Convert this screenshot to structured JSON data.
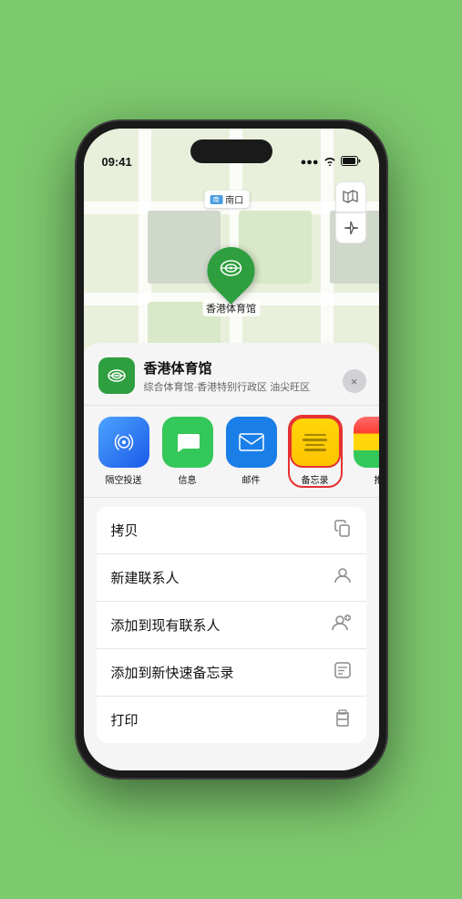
{
  "status_bar": {
    "time": "09:41",
    "location_arrow": "▶",
    "signal": "●●●",
    "wifi": "WiFi",
    "battery": "🔋"
  },
  "map": {
    "label_text": "南口",
    "controls": {
      "map_icon": "🗺",
      "location_icon": "➤"
    }
  },
  "venue": {
    "name": "香港体育馆",
    "subtitle": "综合体育馆·香港特别行政区 油尖旺区",
    "close_label": "×"
  },
  "share_items": [
    {
      "id": "airdrop",
      "label": "隔空投送",
      "icon": "📡"
    },
    {
      "id": "messages",
      "label": "信息",
      "icon": "💬"
    },
    {
      "id": "mail",
      "label": "邮件",
      "icon": "✉"
    },
    {
      "id": "notes",
      "label": "备忘录",
      "icon": "📝"
    },
    {
      "id": "more",
      "label": "推",
      "icon": "⋯"
    }
  ],
  "actions": [
    {
      "id": "copy",
      "label": "拷贝",
      "icon": "⧉"
    },
    {
      "id": "new-contact",
      "label": "新建联系人",
      "icon": "👤"
    },
    {
      "id": "add-contact",
      "label": "添加到现有联系人",
      "icon": "👤+"
    },
    {
      "id": "quick-note",
      "label": "添加到新快速备忘录",
      "icon": "📋"
    },
    {
      "id": "print",
      "label": "打印",
      "icon": "🖨"
    }
  ]
}
